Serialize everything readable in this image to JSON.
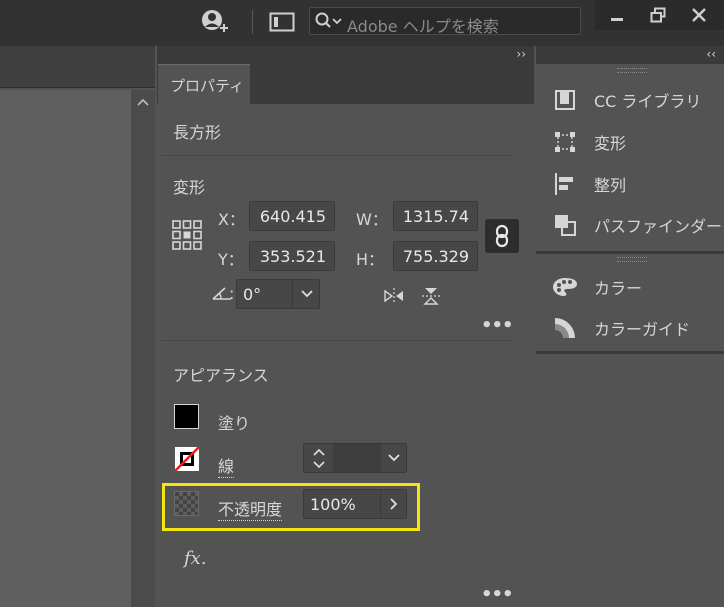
{
  "topbar": {
    "search_placeholder": "Adobe ヘルプを検索",
    "icons": [
      "user-sync-icon",
      "arrange-documents-icon",
      "search-icon",
      "minimize-icon",
      "restore-icon",
      "close-icon"
    ]
  },
  "panel": {
    "collapse_label": "››",
    "tab_label": "プロパティ",
    "selection_type": "長方形",
    "transform": {
      "heading": "変形",
      "x_label": "X：",
      "x_value": "640.415",
      "y_label": "Y：",
      "y_value": "353.521",
      "w_label": "W：",
      "w_value": "1315.74",
      "h_label": "H：",
      "h_value": "755.329",
      "angle_value": "0°",
      "more": "•••"
    },
    "appearance": {
      "heading": "アピアランス",
      "fill_label": "塗り",
      "fill_color": "#000000",
      "stroke_label": "線",
      "stroke_weight": "",
      "opacity_label": "不透明度",
      "opacity_value": "100%",
      "fx_label": "fx.",
      "more": "•••"
    }
  },
  "right_panel": {
    "collapse_label": "‹‹",
    "group1": [
      {
        "label": "CC ライブラリ",
        "icon": "cc-libraries-icon"
      },
      {
        "label": "変形",
        "icon": "transform-icon"
      },
      {
        "label": "整列",
        "icon": "align-icon"
      },
      {
        "label": "パスファインダー",
        "icon": "pathfinder-icon"
      }
    ],
    "group2": [
      {
        "label": "カラー",
        "icon": "color-palette-icon"
      },
      {
        "label": "カラーガイド",
        "icon": "color-guide-icon"
      }
    ]
  },
  "colors": {
    "highlight": "#f1e60f",
    "panel_bg": "#535353",
    "topbar_bg": "#323232"
  }
}
